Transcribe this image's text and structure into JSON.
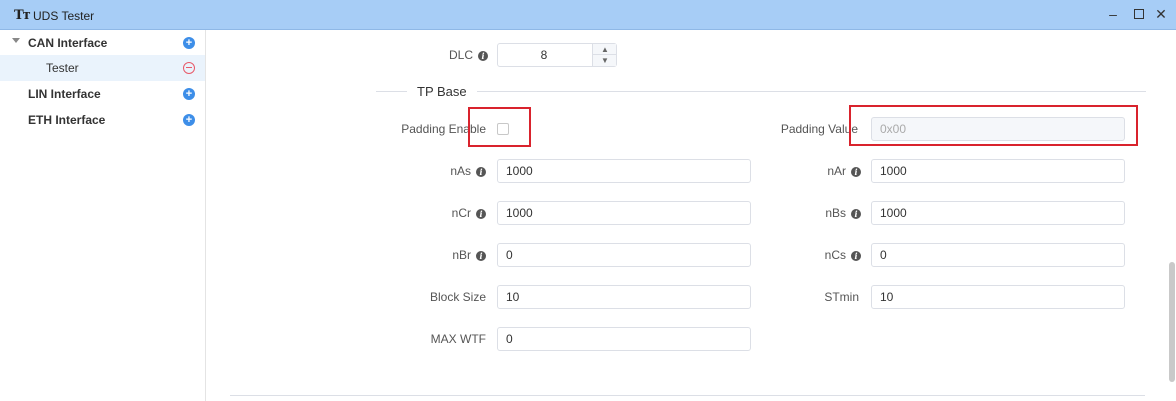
{
  "window": {
    "app_icon": "Tт",
    "title": "UDS Tester",
    "controls": {
      "minimize": "–",
      "maximize_icon": "maximize-icon",
      "close": "✕"
    }
  },
  "sidebar": {
    "items": [
      {
        "label": "CAN Interface",
        "icon": "plus-circle-icon",
        "expanded": true
      },
      {
        "label": "Tester",
        "icon": "minus-circle-icon",
        "selected": true
      },
      {
        "label": "LIN Interface",
        "icon": "plus-circle-icon"
      },
      {
        "label": "ETH Interface",
        "icon": "plus-circle-icon"
      }
    ]
  },
  "form": {
    "dlc": {
      "label": "DLC",
      "value": "8"
    },
    "section_title": "TP Base",
    "padding_enable": {
      "label": "Padding Enable",
      "checked": false
    },
    "padding_value": {
      "label": "Padding Value",
      "placeholder": "0x00",
      "disabled": true
    },
    "nAs": {
      "label": "nAs",
      "value": "1000"
    },
    "nAr": {
      "label": "nAr",
      "value": "1000"
    },
    "nCr": {
      "label": "nCr",
      "value": "1000"
    },
    "nBs": {
      "label": "nBs",
      "value": "1000"
    },
    "nBr": {
      "label": "nBr",
      "value": "0"
    },
    "nCs": {
      "label": "nCs",
      "value": "0"
    },
    "block_size": {
      "label": "Block Size",
      "value": "10"
    },
    "stmin": {
      "label": "STmin",
      "value": "10"
    },
    "max_wtf": {
      "label": "MAX WTF",
      "value": "0"
    }
  },
  "colors": {
    "titlebar": "#a7cdf6",
    "accent": "#3d8ee8",
    "highlight": "#d9232d",
    "remove": "#e85a6a"
  }
}
